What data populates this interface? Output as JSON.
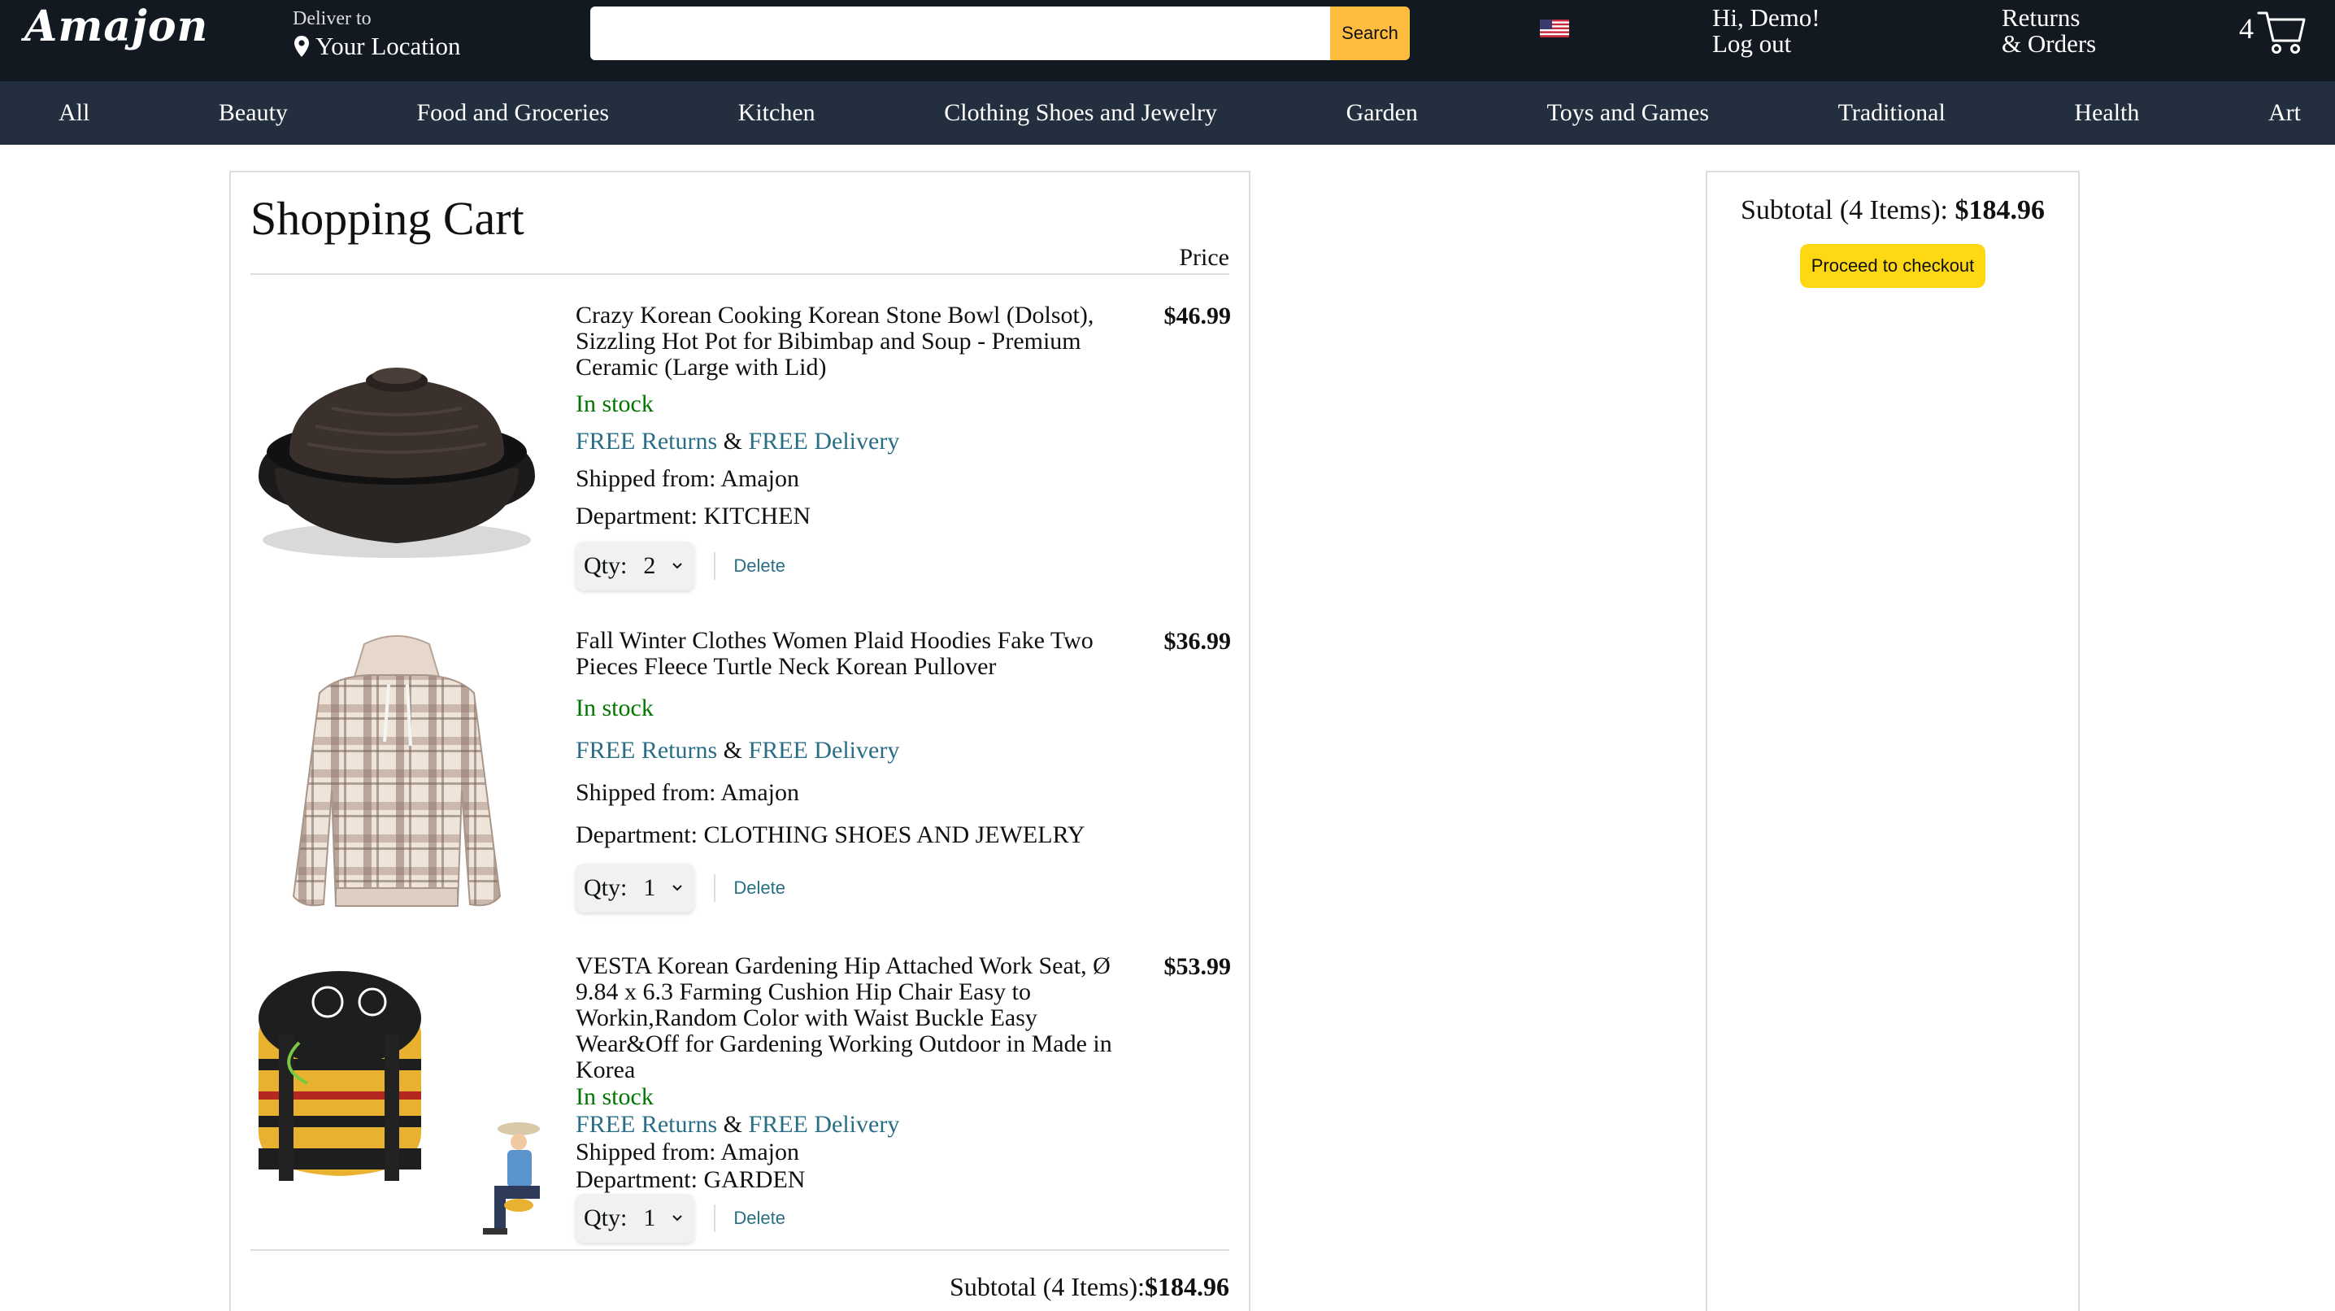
{
  "header": {
    "logo": "Amajon",
    "deliver_small": "Deliver to",
    "deliver_location": "Your Location",
    "search_placeholder": "",
    "search_value": "",
    "search_button": "Search",
    "greeting": "Hi, Demo!",
    "logout": "Log out",
    "returns_line1": "Returns",
    "returns_line2": "& Orders",
    "cart_count": "4"
  },
  "nav": {
    "items": [
      "All",
      "Beauty",
      "Food and Groceries",
      "Kitchen",
      "Clothing Shoes and Jewelry",
      "Garden",
      "Toys and Games",
      "Traditional",
      "Health",
      "Art"
    ]
  },
  "cart": {
    "title": "Shopping Cart",
    "price_header": "Price",
    "qty_label": "Qty:",
    "delete_label": "Delete",
    "free_returns": "FREE Returns",
    "amp": "&",
    "free_delivery": "FREE Delivery",
    "items": [
      {
        "title": "Crazy Korean Cooking Korean Stone Bowl (Dolsot), Sizzling Hot Pot for Bibimbap and Soup - Premium Ceramic (Large with Lid)",
        "price": "$46.99",
        "stock": "In stock",
        "shipped": "Shipped from: Amajon",
        "department": "Department: KITCHEN",
        "qty": "2"
      },
      {
        "title": "Fall Winter Clothes Women Plaid Hoodies Fake Two Pieces Fleece Turtle Neck Korean Pullover",
        "price": "$36.99",
        "stock": "In stock",
        "shipped": "Shipped from: Amajon",
        "department": "Department: CLOTHING SHOES AND JEWELRY",
        "qty": "1"
      },
      {
        "title": "VESTA Korean Gardening Hip Attached Work Seat, Ø 9.84 x 6.3 Farming Cushion Hip Chair Easy to Workin,Random Color with Waist Buckle Easy Wear&Off for Gardening Working Outdoor in Made in Korea",
        "price": "$53.99",
        "stock": "In stock",
        "shipped": "Shipped from: Amajon",
        "department": "Department: GARDEN",
        "qty": "1"
      }
    ],
    "bottom_subtotal_label": "Subtotal (4 Items):",
    "bottom_subtotal_value": "$184.96"
  },
  "summary": {
    "subtotal_label": "Subtotal (4 Items):",
    "subtotal_value": "$184.96",
    "checkout_button": "Proceed to checkout"
  },
  "colors": {
    "header_bg": "#131921",
    "nav_bg": "#232f3e",
    "search_button": "#febd3f",
    "checkout_button": "#ffd814",
    "in_stock": "#007600",
    "link": "#2a6e86"
  }
}
